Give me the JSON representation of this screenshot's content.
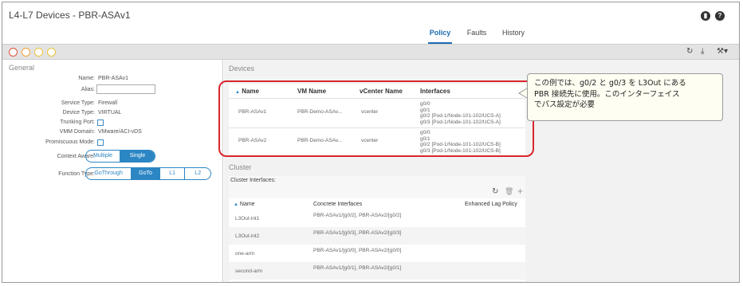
{
  "window": {
    "title": "L4-L7 Devices - PBR-ASAv1",
    "tabs": [
      {
        "label": "Policy",
        "active": true
      },
      {
        "label": "Faults",
        "active": false
      },
      {
        "label": "History",
        "active": false
      }
    ]
  },
  "general": {
    "section_label": "General",
    "name_label": "Name:",
    "name_value": "PBR-ASAv1",
    "alias_label": "Alias:",
    "alias_value": "",
    "service_type_label": "Service Type:",
    "service_type_value": "Firewall",
    "device_type_label": "Device Type:",
    "device_type_value": "VIRTUAL",
    "trunking_port_label": "Trunking Port:",
    "vmm_domain_label": "VMM Domain:",
    "vmm_domain_value": "VMware/ACI-vDS",
    "promiscuous_label": "Promiscuous Mode:",
    "context_aware_label": "Context Aware:",
    "context_aware_options": [
      "Multiple",
      "Single"
    ],
    "context_aware_selected": "Single",
    "function_type_label": "Function Type:",
    "function_type_options": [
      "GoThrough",
      "GoTo",
      "L1",
      "L2"
    ],
    "function_type_selected": "GoTo"
  },
  "devices": {
    "section_label": "Devices",
    "columns": [
      "Name",
      "VM Name",
      "vCenter Name",
      "Interfaces"
    ],
    "rows": [
      {
        "name": "PBR-ASAv1",
        "vm_name": "PBR-Demo-ASAv...",
        "vcenter": "vcenter",
        "interfaces": [
          "g0/0",
          "g0/1",
          "g0/2 [Pod-1/Node-101-102/UCS-A]",
          "g0/3 [Pod-1/Node-101-102/UCS-A]"
        ]
      },
      {
        "name": "PBR-ASAv2",
        "vm_name": "PBR-Demo-ASAv...",
        "vcenter": "vcenter",
        "interfaces": [
          "g0/0",
          "g0/1",
          "g0/2 [Pod-1/Node-101-102/UCS-B]",
          "g0/3 [Pod-1/Node-101-102/UCS-B]"
        ]
      }
    ]
  },
  "cluster": {
    "section_label": "Cluster",
    "interfaces_label": "Cluster Interfaces:",
    "columns": [
      "Name",
      "Concrete Interfaces",
      "Enhanced Lag Policy"
    ],
    "rows": [
      {
        "name": "L3Out-int1",
        "concrete": "PBR-ASAv1/[g0/2], PBR-ASAv2/[g0/2]"
      },
      {
        "name": "L3Out-int2",
        "concrete": "PBR-ASAv1/[g0/3], PBR-ASAv2/[g0/3]"
      },
      {
        "name": "one-arm",
        "concrete": "PBR-ASAv1/[g0/0], PBR-ASAv2/[g0/0]"
      },
      {
        "name": "second-arm",
        "concrete": "PBR-ASAv1/[g0/1], PBR-ASAv2/[g0/1]"
      }
    ]
  },
  "callout": {
    "lines": [
      "この例では、g0/2 と g0/3 を L3Out にある",
      "PBR 接続先に使用。このインターフェイス",
      "でパス設定が必要"
    ]
  },
  "icons": {
    "bookmark": "bookmark-icon",
    "help": "help-icon",
    "refresh": "refresh-icon",
    "download": "download-icon",
    "tools": "tools-icon",
    "add": "add-icon",
    "delete": "delete-icon"
  },
  "colors": {
    "accent": "#2c86c4",
    "highlight_border": "#d9262c",
    "dot_red": "#e0563b",
    "dot_orange": "#f0a23a",
    "dot_yellow": "#e8c33a"
  }
}
